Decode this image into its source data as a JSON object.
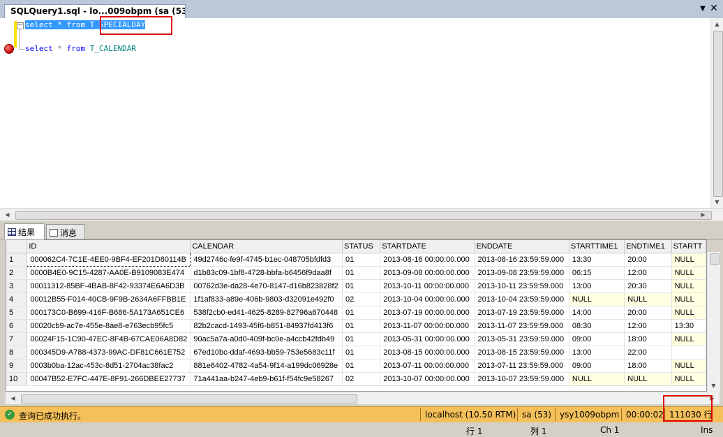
{
  "tab": {
    "title": "SQLQuery1.sql - lo...009obpm (sa (53))*",
    "close_glyph": "✕",
    "pin_glyph": "▼"
  },
  "editor": {
    "line1": {
      "kw1": "select",
      "op": "*",
      "kw2": "from",
      "table": "T_SPECIALDAY"
    },
    "line2": {
      "kw1": "select",
      "op": "*",
      "kw2": "from",
      "table": "T_CALENDAR"
    },
    "collapse_glyph": "−"
  },
  "result_tabs": {
    "results_label": "结果",
    "messages_label": "消息"
  },
  "grid": {
    "columns": [
      "ID",
      "CALENDAR",
      "STATUS",
      "STARTDATE",
      "ENDDATE",
      "STARTTIME1",
      "ENDTIME1",
      "STARTT"
    ],
    "rows": [
      [
        "1",
        "000062C4-7C1E-4EE0-9BF4-EF201D80114B",
        "49d2746c-fe9f-4745-b1ec-048705bfdfd3",
        "01",
        "2013-08-16 00:00:00.000",
        "2013-08-16 23:59:59.000",
        "13:30",
        "20:00",
        "NULL"
      ],
      [
        "2",
        "0000B4E0-9C15-4287-AA0E-B9109083E474",
        "d1b83c09-1bf8-4728-bbfa-b6456f9daa8f",
        "01",
        "2013-09-08 00:00:00.000",
        "2013-09-08 23:59:59.000",
        "06:15",
        "12:00",
        "NULL"
      ],
      [
        "3",
        "00011312-85BF-4BAB-8F42-93374E6A6D3B",
        "00762d3e-da28-4e70-8147-d16b823828f2",
        "01",
        "2013-10-11 00:00:00.000",
        "2013-10-11 23:59:59.000",
        "13:00",
        "20:30",
        "NULL"
      ],
      [
        "4",
        "00012B55-F014-40CB-9F9B-2634A6FFBB1E",
        "1f1af833-a89e-406b-9803-d32091e492f0",
        "02",
        "2013-10-04 00:00:00.000",
        "2013-10-04 23:59:59.000",
        "NULL",
        "NULL",
        "NULL"
      ],
      [
        "5",
        "000173C0-B699-416F-B686-5A173A651CE6",
        "538f2cb0-ed41-4625-8289-82796a670448",
        "01",
        "2013-07-19 00:00:00.000",
        "2013-07-19 23:59:59.000",
        "14:00",
        "20:00",
        "NULL"
      ],
      [
        "6",
        "00020cb9-ac7e-455e-8ae8-e763ecb95fc5",
        "82b2cacd-1493-45f6-b851-84937fd413f6",
        "01",
        "2013-11-07 00:00:00.000",
        "2013-11-07 23:59:59.000",
        "08:30",
        "12:00",
        "13:30"
      ],
      [
        "7",
        "00024F15-1C90-47EC-8F4B-67CAE06A8D82",
        "90ac5a7a-a0d0-409f-bc0e-a4ccb42fdb49",
        "01",
        "2013-05-31 00:00:00.000",
        "2013-05-31 23:59:59.000",
        "09:00",
        "18:00",
        "NULL"
      ],
      [
        "8",
        "000345D9-A788-4373-99AC-DF81C661E752",
        "67ed10bc-ddaf-4693-bb59-753e5683c11f",
        "01",
        "2013-08-15 00:00:00.000",
        "2013-08-15 23:59:59.000",
        "13:00",
        "22:00",
        ""
      ],
      [
        "9",
        "0003b0ba-12ac-453c-8d51-2704ac38fac2",
        "881e6402-4782-4a54-9f14-a199dc06928e",
        "01",
        "2013-07-11 00:00:00.000",
        "2013-07-11 23:59:59.000",
        "09:00",
        "18:00",
        "NULL"
      ],
      [
        "10",
        "00047B52-E7FC-447E-8F91-266DBEE27737",
        "71a441aa-b247-4eb9-b61f-f54fc9e58267",
        "02",
        "2013-10-07 00:00:00.000",
        "2013-10-07 23:59:59.000",
        "NULL",
        "NULL",
        "NULL"
      ]
    ]
  },
  "status": {
    "message": "查询已成功执行。",
    "server": "localhost (10.50 RTM)",
    "user": "sa (53)",
    "database": "ysy1009obpm",
    "elapsed": "00:00:02",
    "rows": "111030 行"
  },
  "bottom": {
    "line": "行 1",
    "col": "列 1",
    "ch": "Ch 1",
    "mode": "Ins"
  },
  "colors": {
    "selection": "#3399ff",
    "keyword": "#0000ff",
    "table_name": "#008080",
    "status_bar": "#f5c05a",
    "highlight_box": "#e00000",
    "null_cell": "#ffffe1"
  }
}
